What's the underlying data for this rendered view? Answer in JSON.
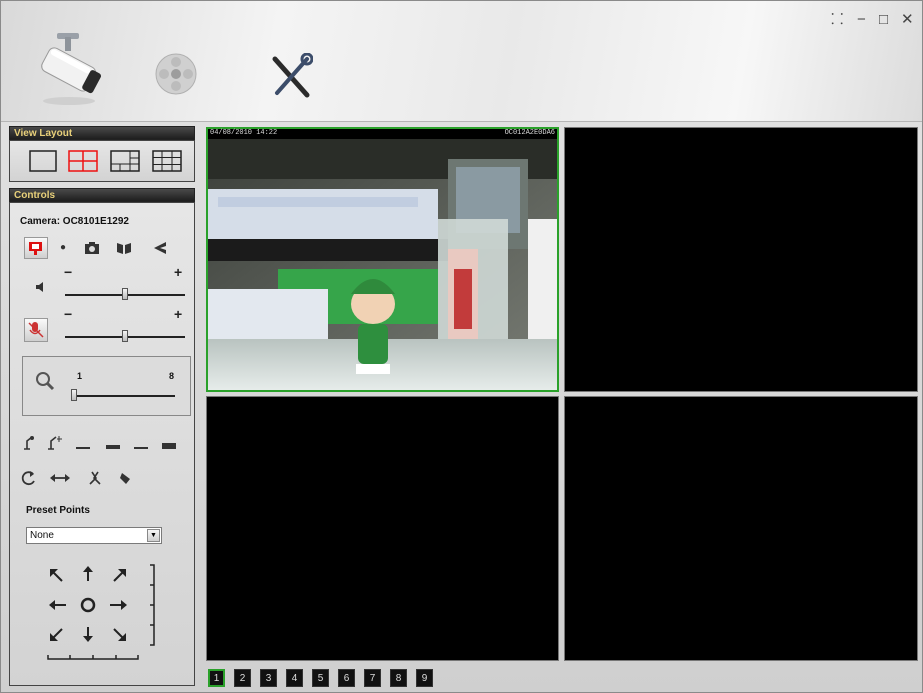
{
  "window": {
    "restore_icon": "⸬",
    "minimize_icon": "−",
    "maximize_icon": "□",
    "close_icon": "✕"
  },
  "toolbar": {
    "camera_icon": "cctv-camera-icon",
    "playback_icon": "film-reel-icon",
    "settings_icon": "tools-icon"
  },
  "view_layout": {
    "title": "View Layout",
    "options": [
      "single",
      "quad",
      "1+5",
      "3x3"
    ],
    "selected": "quad"
  },
  "controls": {
    "title": "Controls",
    "camera_label": "Camera: OC8101E1292",
    "audio_minus": "−",
    "audio_plus": "+",
    "speaker_level": 0.5,
    "mic_level": 0.5,
    "zoom_min": "1",
    "zoom_max": "8",
    "zoom_level": 1,
    "preset_label": "Preset Points",
    "preset_selected": "None"
  },
  "viewer": {
    "active_overlay_left": "04/08/2010 14:22",
    "active_overlay_right": "OC012A2E0DA6"
  },
  "pages": [
    "1",
    "2",
    "3",
    "4",
    "5",
    "6",
    "7",
    "8",
    "9"
  ],
  "active_page": "1",
  "colors": {
    "active_border": "#2aa12a",
    "header_gold": "#e8d07a"
  }
}
